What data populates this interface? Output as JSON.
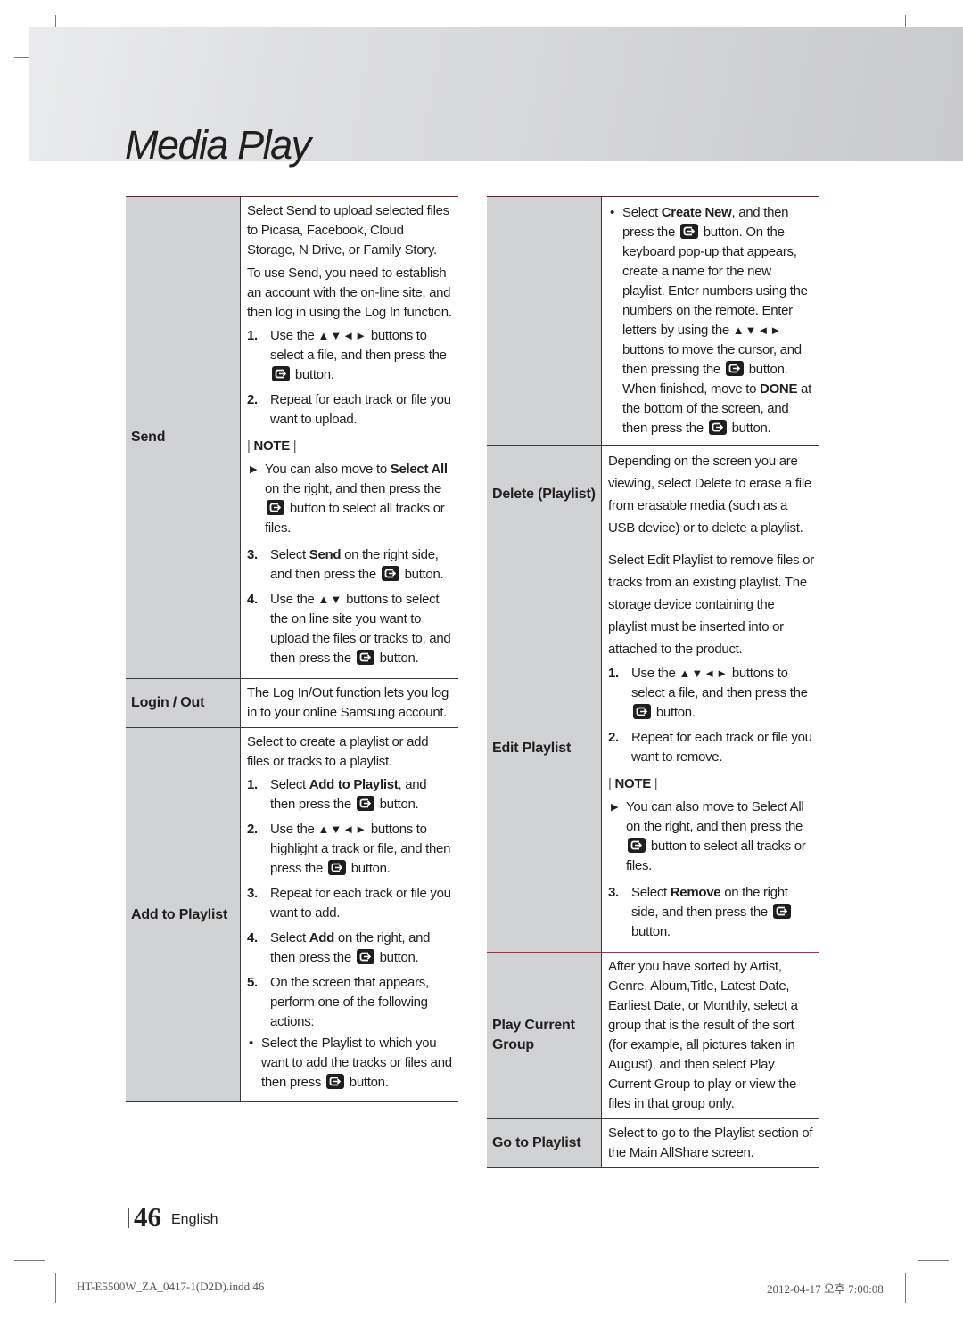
{
  "header": {
    "title": "Media Play"
  },
  "icons": {
    "enter": "enter-button-icon",
    "arrows4": "▲▼◄►",
    "arrows2": "▲▼",
    "note_tip": "▶"
  },
  "left_table": {
    "send": {
      "label": "Send",
      "intro1": "Select Send to upload selected files to Picasa, Facebook, Cloud Storage, N Drive, or Family Story.",
      "intro2": "To use Send, you need to establish an account with the on-line site, and then log in using the Log In function.",
      "step1_num": "1.",
      "step1_a": "Use the",
      "step1_b": "buttons to select a file, and then press the",
      "step1_c": "button.",
      "step2_num": "2.",
      "step2": "Repeat for each track or file you want to upload.",
      "note_label": "NOTE",
      "note_a": "You can also move to",
      "note_bold": "Select All",
      "note_b": "on the right, and then press the",
      "note_c": "button to select all tracks or files.",
      "step3_num": "3.",
      "step3_a": "Select",
      "step3_bold": "Send",
      "step3_b": "on the right side, and then press the",
      "step3_c": "button.",
      "step4_num": "4.",
      "step4_a": "Use the",
      "step4_b": "buttons to select the on line site you want to upload the files or tracks to, and then press the",
      "step4_c": "button."
    },
    "login": {
      "label": "Login / Out",
      "desc": "The Log In/Out function lets you log in to your online Samsung account."
    },
    "add_to_playlist": {
      "label": "Add to Playlist",
      "intro": "Select to create a playlist or add files or tracks to a playlist.",
      "step1_num": "1.",
      "step1_a": "Select",
      "step1_bold": "Add to Playlist",
      "step1_b": ", and then press the",
      "step1_c": "button.",
      "step2_num": "2.",
      "step2_a": "Use the",
      "step2_b": "buttons to highlight a track or file, and then press the",
      "step2_c": "button.",
      "step3_num": "3.",
      "step3": "Repeat for each track or file you want to add.",
      "step4_num": "4.",
      "step4_a": "Select",
      "step4_bold": "Add",
      "step4_b": "on the right, and then press the",
      "step4_c": "button.",
      "step5_num": "5.",
      "step5": "On the screen that appears, perform one of the following actions:",
      "bullet1_a": "Select the Playlist to which you want to add the tracks or files and then press",
      "bullet1_b": "button."
    }
  },
  "right_table": {
    "create_new": {
      "bullet_a": "Select",
      "bullet_bold": "Create New",
      "bullet_b": ", and then press the",
      "bullet_c": "button. On the keyboard pop-up that appears, create a name for the new playlist. Enter numbers using the numbers on the remote. Enter letters by using the",
      "bullet_d": "buttons to move the cursor, and then pressing the",
      "bullet_e": "button. When finished, move to",
      "bullet_bold2": "DONE",
      "bullet_f": "at the bottom of the screen, and then press the",
      "bullet_g": "button."
    },
    "delete": {
      "label": "Delete (Playlist)",
      "desc": "Depending on the screen you are viewing, select Delete to erase a file from erasable media (such as a USB device) or to delete a playlist."
    },
    "edit": {
      "label": "Edit Playlist",
      "intro": "Select Edit Playlist to remove files or tracks from an existing playlist. The storage device containing the playlist must be inserted into or attached to the product.",
      "step1_num": "1.",
      "step1_a": "Use the",
      "step1_b": "buttons to select a file, and then press the",
      "step1_c": "button.",
      "step2_num": "2.",
      "step2": "Repeat for each track or file you want to remove.",
      "note_label": "NOTE",
      "note_a": "You can also move to Select All on the right, and then press the",
      "note_b": "button to select all tracks or files.",
      "step3_num": "3.",
      "step3_a": "Select",
      "step3_bold": "Remove",
      "step3_b": "on the right side, and then press the",
      "step3_c": "button."
    },
    "play_group": {
      "label": "Play Current Group",
      "desc": "After you have sorted by Artist, Genre, Album,Title, Latest Date, Earliest Date, or Monthly, select a group that is the result of the sort (for example, all pictures taken in August), and then select Play Current Group to play or view the files in that group only."
    },
    "goto": {
      "label": "Go to Playlist",
      "desc": "Select to go to the Playlist section of the Main AllShare screen."
    }
  },
  "footer": {
    "page_number": "46",
    "language": "English",
    "slug_file": "HT-E5500W_ZA_0417-1(D2D).indd   46",
    "slug_date": "2012-04-17   오후 7:00:08"
  }
}
